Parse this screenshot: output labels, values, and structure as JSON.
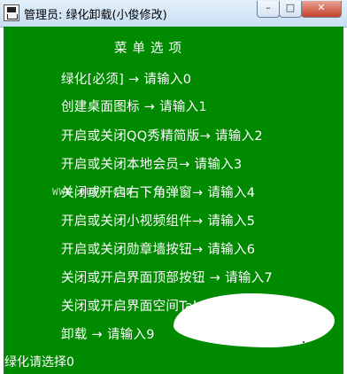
{
  "window": {
    "title": "管理员: 绿化卸载(小俊修改)",
    "minimize_glyph": "–",
    "maximize_glyph": "□",
    "close_glyph": "✕",
    "icon": "cmd-window-icon"
  },
  "console": {
    "background": "#008a00",
    "text_color": "#ffffff",
    "header": "菜单选项",
    "items": [
      "绿化[必须] → 请输入0",
      "创建桌面图标 → 请输入1",
      "开启或关闭QQ秀精简版→ 请输入2",
      "开启或关闭本地会员→ 请输入3",
      "关闭或开启右下角弹窗→ 请输入4",
      "开启或关闭小视频组件→ 请输入5",
      "开启或关闭勋章墙按钮→ 请输入6",
      "关闭或开启界面顶部按钮 → 请输入7",
      "关闭或开启界面空间Tab → 请输入8",
      "卸载 → 请输入9"
    ],
    "watermark": "WWW.OUPK.COM",
    "prompt": "绿化请选择0"
  }
}
